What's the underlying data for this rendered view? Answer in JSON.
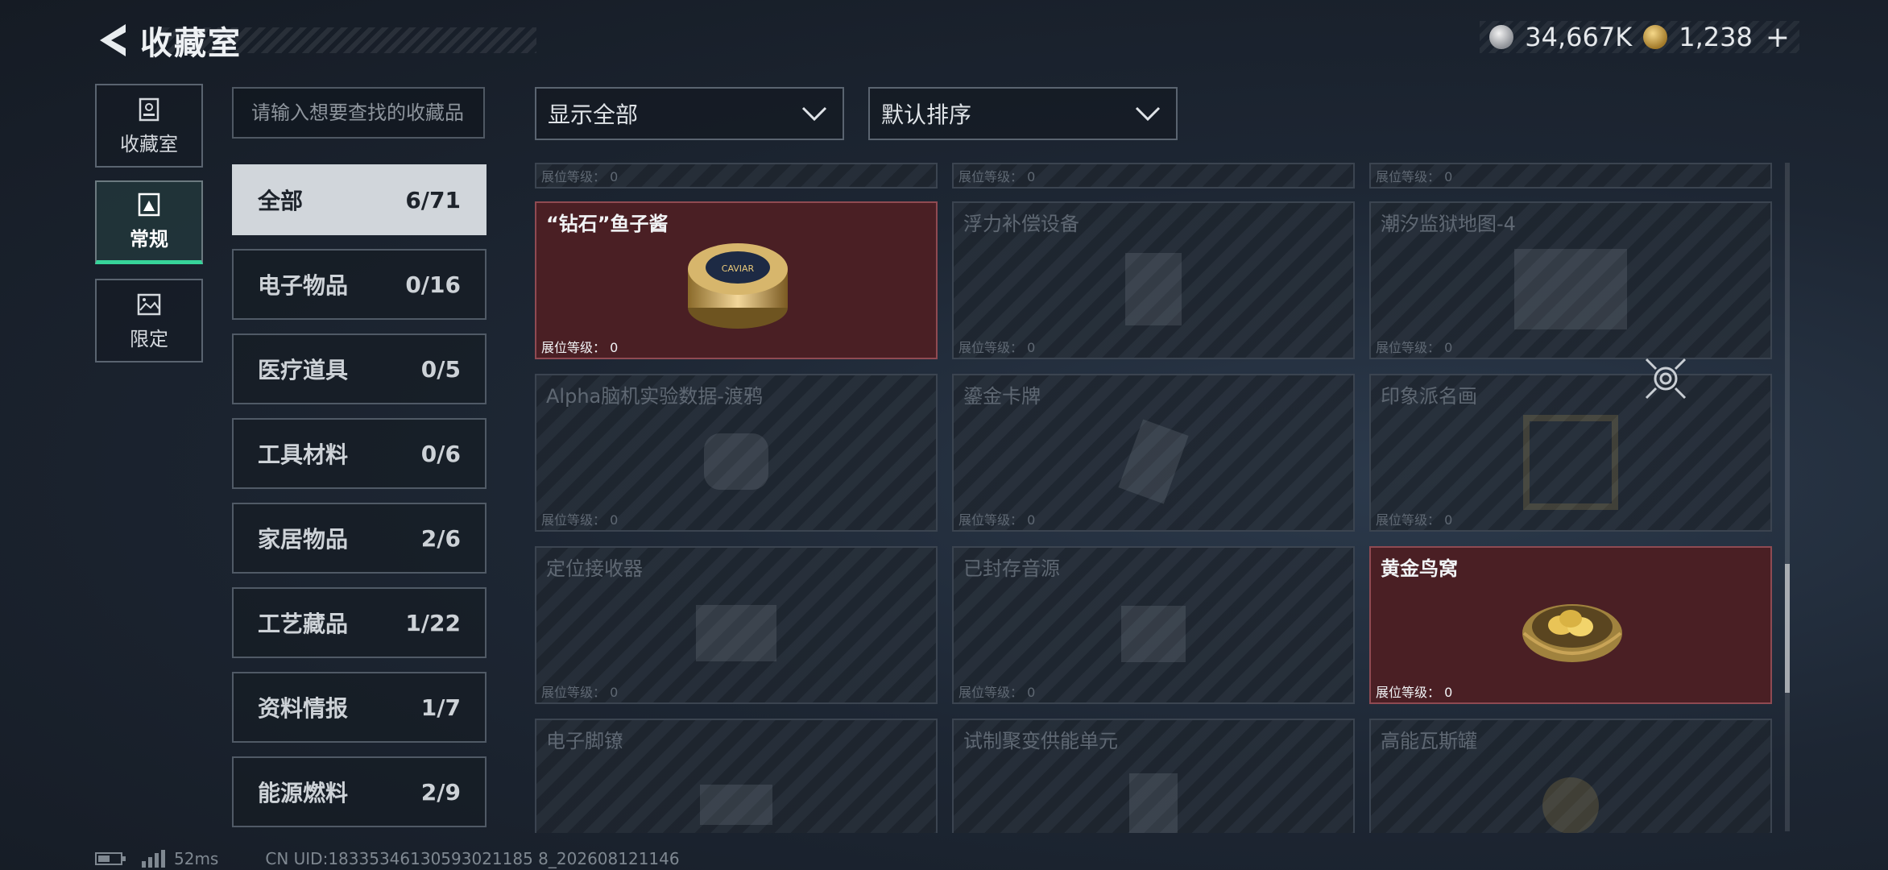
{
  "header": {
    "title": "收藏室"
  },
  "currency": {
    "silver_amount": "34,667K",
    "gold_amount": "1,238",
    "plus": "+"
  },
  "side_tabs": [
    {
      "label": "收藏室",
      "icon": "building-icon"
    },
    {
      "label": "常规",
      "icon": "collection-icon",
      "active": true
    },
    {
      "label": "限定",
      "icon": "landscape-icon"
    }
  ],
  "search": {
    "placeholder": "请输入想要查找的收藏品"
  },
  "categories": [
    {
      "name": "全部",
      "count": "6/71",
      "active": true
    },
    {
      "name": "电子物品",
      "count": "0/16"
    },
    {
      "name": "医疗道具",
      "count": "0/5"
    },
    {
      "name": "工具材料",
      "count": "0/6"
    },
    {
      "name": "家居物品",
      "count": "2/6"
    },
    {
      "name": "工艺藏品",
      "count": "1/22"
    },
    {
      "name": "资料情报",
      "count": "1/7"
    },
    {
      "name": "能源燃料",
      "count": "2/9"
    }
  ],
  "filters": {
    "display": "显示全部",
    "sort": "默认排序"
  },
  "level_label": "展位等级：",
  "cards": [
    {
      "name": "",
      "level": "0",
      "owned": false
    },
    {
      "name": "",
      "level": "0",
      "owned": false
    },
    {
      "name": "",
      "level": "0",
      "owned": false
    },
    {
      "name": "“钻石”鱼子酱",
      "level": "0",
      "owned": true,
      "item_text": "CAVIAR"
    },
    {
      "name": "浮力补偿设备",
      "level": "0",
      "owned": false
    },
    {
      "name": "潮汐监狱地图-4",
      "level": "0",
      "owned": false
    },
    {
      "name": "Alpha脑机实验数据-渡鸦",
      "level": "0",
      "owned": false
    },
    {
      "name": "鎏金卡牌",
      "level": "0",
      "owned": false
    },
    {
      "name": "印象派名画",
      "level": "0",
      "owned": false
    },
    {
      "name": "定位接收器",
      "level": "0",
      "owned": false
    },
    {
      "name": "已封存音源",
      "level": "0",
      "owned": false
    },
    {
      "name": "黄金鸟窝",
      "level": "0",
      "owned": true
    },
    {
      "name": "电子脚镣",
      "level": "",
      "owned": false
    },
    {
      "name": "试制聚变供能单元",
      "level": "",
      "owned": false
    },
    {
      "name": "高能瓦斯罐",
      "level": "",
      "owned": false
    }
  ],
  "status": {
    "ping": "52ms",
    "uid": "CN UID:18335346130593021185 8_202608121146"
  },
  "colors": {
    "owned_card": "#4a1f24",
    "active_tab_accent": "#37d39a"
  }
}
